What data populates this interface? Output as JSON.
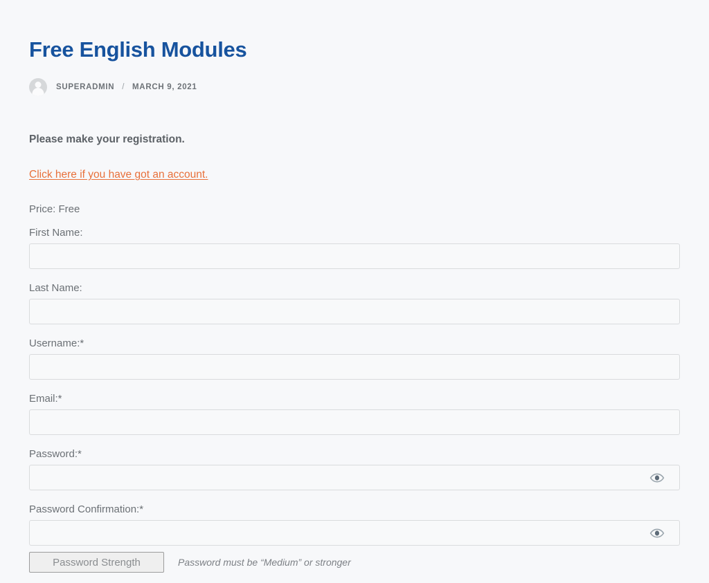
{
  "post": {
    "title": "Free English Modules",
    "author": "SUPERADMIN",
    "separator": "/",
    "date": "MARCH 9, 2021"
  },
  "content": {
    "intro": "Please make your registration.",
    "account_link": "Click here if you have got an account.",
    "price": "Price: Free"
  },
  "form": {
    "fields": [
      {
        "label": "First Name:",
        "value": "",
        "placeholder": "",
        "type": "text"
      },
      {
        "label": "Last Name:",
        "value": "",
        "placeholder": "",
        "type": "text"
      },
      {
        "label": "Username:*",
        "value": "",
        "placeholder": "",
        "type": "text"
      },
      {
        "label": "Email:*",
        "value": "",
        "placeholder": "",
        "type": "text"
      },
      {
        "label": "Password:*",
        "value": "",
        "placeholder": "",
        "type": "password"
      },
      {
        "label": "Password Confirmation:*",
        "value": "",
        "placeholder": "",
        "type": "password"
      }
    ],
    "strength_button_label": "Password Strength",
    "strength_hint": "Password must be “Medium” or stronger",
    "toggle_icon": "eye-icon"
  },
  "colors": {
    "title_blue": "#17539e",
    "link_orange": "#e8703a",
    "page_background": "#f7f8fa",
    "input_border": "#d9dbdd",
    "label_grey": "#6b7075"
  }
}
